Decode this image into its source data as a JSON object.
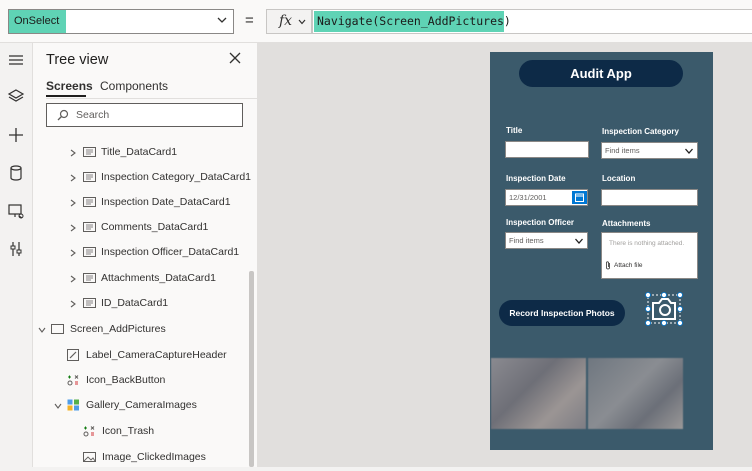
{
  "formula_bar": {
    "property": "OnSelect",
    "equals": "=",
    "fx_label": "fx",
    "formula": "Navigate(Screen_AddPictures)"
  },
  "tree_view": {
    "title": "Tree view",
    "tabs": [
      "Screens",
      "Components"
    ],
    "active_tab": "Screens",
    "search_placeholder": "Search",
    "items": [
      {
        "label": "Title_DataCard1",
        "icon": "card-icon",
        "expand": "collapsed"
      },
      {
        "label": "Inspection Category_DataCard1",
        "icon": "card-icon",
        "expand": "collapsed"
      },
      {
        "label": "Inspection Date_DataCard1",
        "icon": "card-icon",
        "expand": "collapsed"
      },
      {
        "label": "Comments_DataCard1",
        "icon": "card-icon",
        "expand": "collapsed"
      },
      {
        "label": "Inspection Officer_DataCard1",
        "icon": "card-icon",
        "expand": "collapsed"
      },
      {
        "label": "Attachments_DataCard1",
        "icon": "card-icon",
        "expand": "collapsed"
      },
      {
        "label": "ID_DataCard1",
        "icon": "card-icon",
        "expand": "collapsed"
      },
      {
        "label": "Screen_AddPictures",
        "icon": "screen-icon",
        "expand": "expanded"
      },
      {
        "label": "Label_CameraCaptureHeader",
        "icon": "label-icon",
        "expand": "none"
      },
      {
        "label": "Icon_BackButton",
        "icon": "icon-control-icon",
        "expand": "none"
      },
      {
        "label": "Gallery_CameraImages",
        "icon": "gallery-icon",
        "expand": "expanded"
      },
      {
        "label": "Icon_Trash",
        "icon": "icon-control-icon",
        "expand": "none"
      },
      {
        "label": "Image_ClickedImages",
        "icon": "image-icon",
        "expand": "none"
      }
    ]
  },
  "app": {
    "title": "Audit App",
    "fields": {
      "title_label": "Title",
      "category_label": "Inspection Category",
      "category_placeholder": "Find items",
      "date_label": "Inspection Date",
      "date_value": "12/31/2001",
      "location_label": "Location",
      "officer_label": "Inspection Officer",
      "officer_placeholder": "Find items",
      "attachments_label": "Attachments",
      "attachments_empty": "There is nothing attached.",
      "attach_file": "Attach file"
    },
    "record_button": "Record Inspection Photos"
  },
  "colors": {
    "highlight": "#5fd3b5",
    "app_background": "#3b5a6b",
    "button_navy": "#0d2a47",
    "accent_blue": "#0078d4"
  }
}
